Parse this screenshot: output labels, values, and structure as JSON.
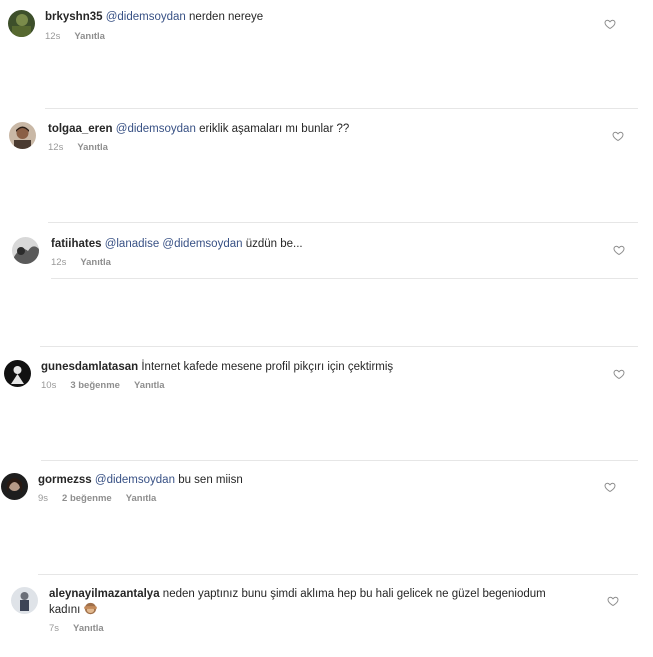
{
  "comments": [
    {
      "user": "brkyshn35",
      "mentions": [
        "@didemsoydan"
      ],
      "text": "nerden nereye",
      "time": "12s",
      "likes": "",
      "reply": "Yanıtla",
      "avatar": "avatar-dark-green"
    },
    {
      "user": "tolgaa_eren",
      "mentions": [
        "@didemsoydan"
      ],
      "text": "eriklik aşamaları mı bunlar ??",
      "time": "12s",
      "likes": "",
      "reply": "Yanıtla",
      "avatar": "avatar-man-portrait"
    },
    {
      "user": "fatiihates",
      "mentions": [
        "@lanadise",
        "@didemsoydan"
      ],
      "text": "üzdün be...",
      "time": "12s",
      "likes": "",
      "reply": "Yanıtla",
      "avatar": "avatar-grey-scene"
    },
    {
      "user": "gunesdamlatasan",
      "mentions": [],
      "text": "İnternet kafede mesene profil pikçırı için çektirmiş",
      "time": "10s",
      "likes": "3 beğenme",
      "reply": "Yanıtla",
      "avatar": "avatar-black-figure"
    },
    {
      "user": "gormezss",
      "mentions": [
        "@didemsoydan"
      ],
      "text": "bu sen miisn",
      "time": "9s",
      "likes": "2 beğenme",
      "reply": "Yanıtla",
      "avatar": "avatar-dark-portrait"
    },
    {
      "user": "aleynayilmazantalya",
      "mentions": [],
      "text": "neden yaptınız bunu şimdi aklıma hep bu hali gelicek ne güzel begeniodum",
      "text2": "kadını",
      "emoji": "see-no-evil-monkey-emoji",
      "time": "7s",
      "likes": "",
      "reply": "Yanıtla",
      "avatar": "avatar-small-figure"
    }
  ],
  "icons": {
    "like": "heart-outline-icon"
  },
  "colors": {
    "mention": "#385185",
    "meta": "#999999",
    "divider": "#e6e6e6"
  }
}
